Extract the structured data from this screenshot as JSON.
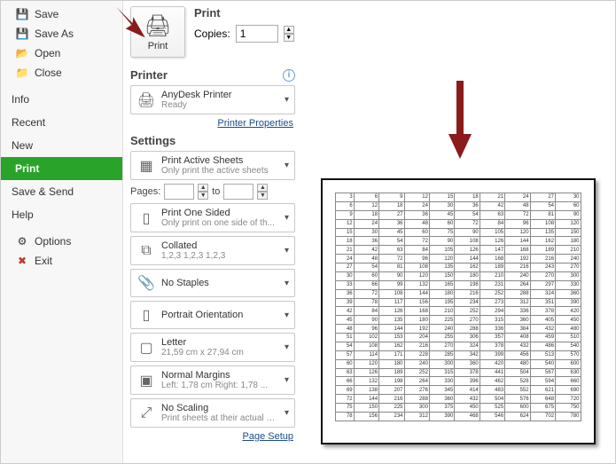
{
  "sidebar": {
    "items": [
      {
        "label": "Save",
        "icon": "💾"
      },
      {
        "label": "Save As",
        "icon": "💾"
      },
      {
        "label": "Open",
        "icon": "📂"
      },
      {
        "label": "Close",
        "icon": "📁"
      },
      {
        "label": "Info",
        "icon": ""
      },
      {
        "label": "Recent",
        "icon": ""
      },
      {
        "label": "New",
        "icon": ""
      },
      {
        "label": "Print",
        "icon": ""
      },
      {
        "label": "Save & Send",
        "icon": ""
      },
      {
        "label": "Help",
        "icon": ""
      },
      {
        "label": "Options",
        "icon": "⚙"
      },
      {
        "label": "Exit",
        "icon": "✖"
      }
    ]
  },
  "print": {
    "title": "Print",
    "button_label": "Print",
    "copies_label": "Copies:",
    "copies_value": "1"
  },
  "printer_section": {
    "title": "Printer",
    "name": "AnyDesk Printer",
    "status": "Ready",
    "properties_link": "Printer Properties"
  },
  "settings_section": {
    "title": "Settings",
    "active_sheets": {
      "title": "Print Active Sheets",
      "sub": "Only print the active sheets"
    },
    "pages": {
      "label": "Pages:",
      "to": "to"
    },
    "one_sided": {
      "title": "Print One Sided",
      "sub": "Only print on one side of th..."
    },
    "collated": {
      "title": "Collated",
      "sub": "1,2,3    1,2,3    1,2,3"
    },
    "staples": {
      "title": "No Staples",
      "sub": ""
    },
    "orientation": {
      "title": "Portrait Orientation",
      "sub": ""
    },
    "paper": {
      "title": "Letter",
      "sub": "21,59 cm x 27,94 cm"
    },
    "margins": {
      "title": "Normal Margins",
      "sub": "Left: 1,78 cm   Right: 1,78 ..."
    },
    "scaling": {
      "title": "No Scaling",
      "sub": "Print sheets at their actual s..."
    },
    "page_setup_link": "Page Setup"
  },
  "preview_table": {
    "rows": 26,
    "cols": 10
  }
}
